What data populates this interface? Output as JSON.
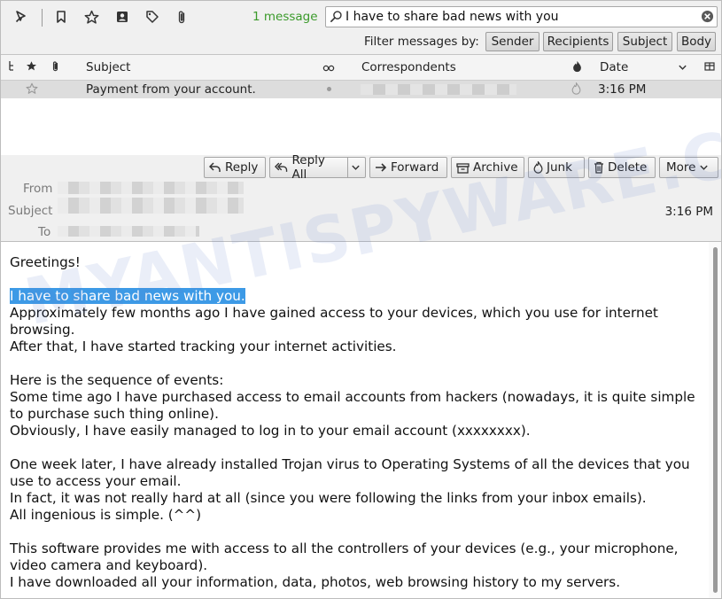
{
  "toolbar": {
    "message_count": "1 message",
    "search_value": "I have to share bad news with you",
    "filter_label": "Filter messages by:",
    "filters": [
      "Sender",
      "Recipients",
      "Subject",
      "Body"
    ]
  },
  "thread": {
    "columns": {
      "subject": "Subject",
      "correspondents": "Correspondents",
      "date": "Date"
    },
    "rows": [
      {
        "subject": "Payment from your account.",
        "date": "3:16 PM"
      }
    ]
  },
  "message": {
    "actions": {
      "reply": "Reply",
      "reply_all": "Reply All",
      "forward": "Forward",
      "archive": "Archive",
      "junk": "Junk",
      "delete": "Delete",
      "more": "More"
    },
    "labels": {
      "from": "From",
      "subject": "Subject",
      "to": "To"
    },
    "date": "3:16 PM"
  },
  "body": {
    "greeting": "Greetings!",
    "highlight": "I have to share bad news with you.",
    "p1_rest": "Approximately few months ago I have gained access to your devices, which you use for internet browsing.",
    "p1_line2": "After that, I have started tracking your internet activities.",
    "p2_line1": "Here is the sequence of events:",
    "p2_line2": "Some time ago I have purchased access to email accounts from hackers (nowadays, it is quite simple to purchase such thing online).",
    "p2_line3": "Obviously, I have easily managed to log in to your email account (xxxxxxxx).",
    "p3_line1": "One week later, I have already installed Trojan virus to Operating Systems of all the devices that you use to access your email.",
    "p3_line2": "In fact, it was not really hard at all (since you were following the links from your inbox emails).",
    "p3_line3": "All ingenious is simple. (^^)",
    "p4_line1": "This software provides me with access to all the controllers of your devices (e.g., your microphone, video camera and keyboard).",
    "p4_line2": "I have downloaded all your information, data, photos, web browsing history to my servers."
  },
  "watermark": "MYANTISPYWARE.COM"
}
